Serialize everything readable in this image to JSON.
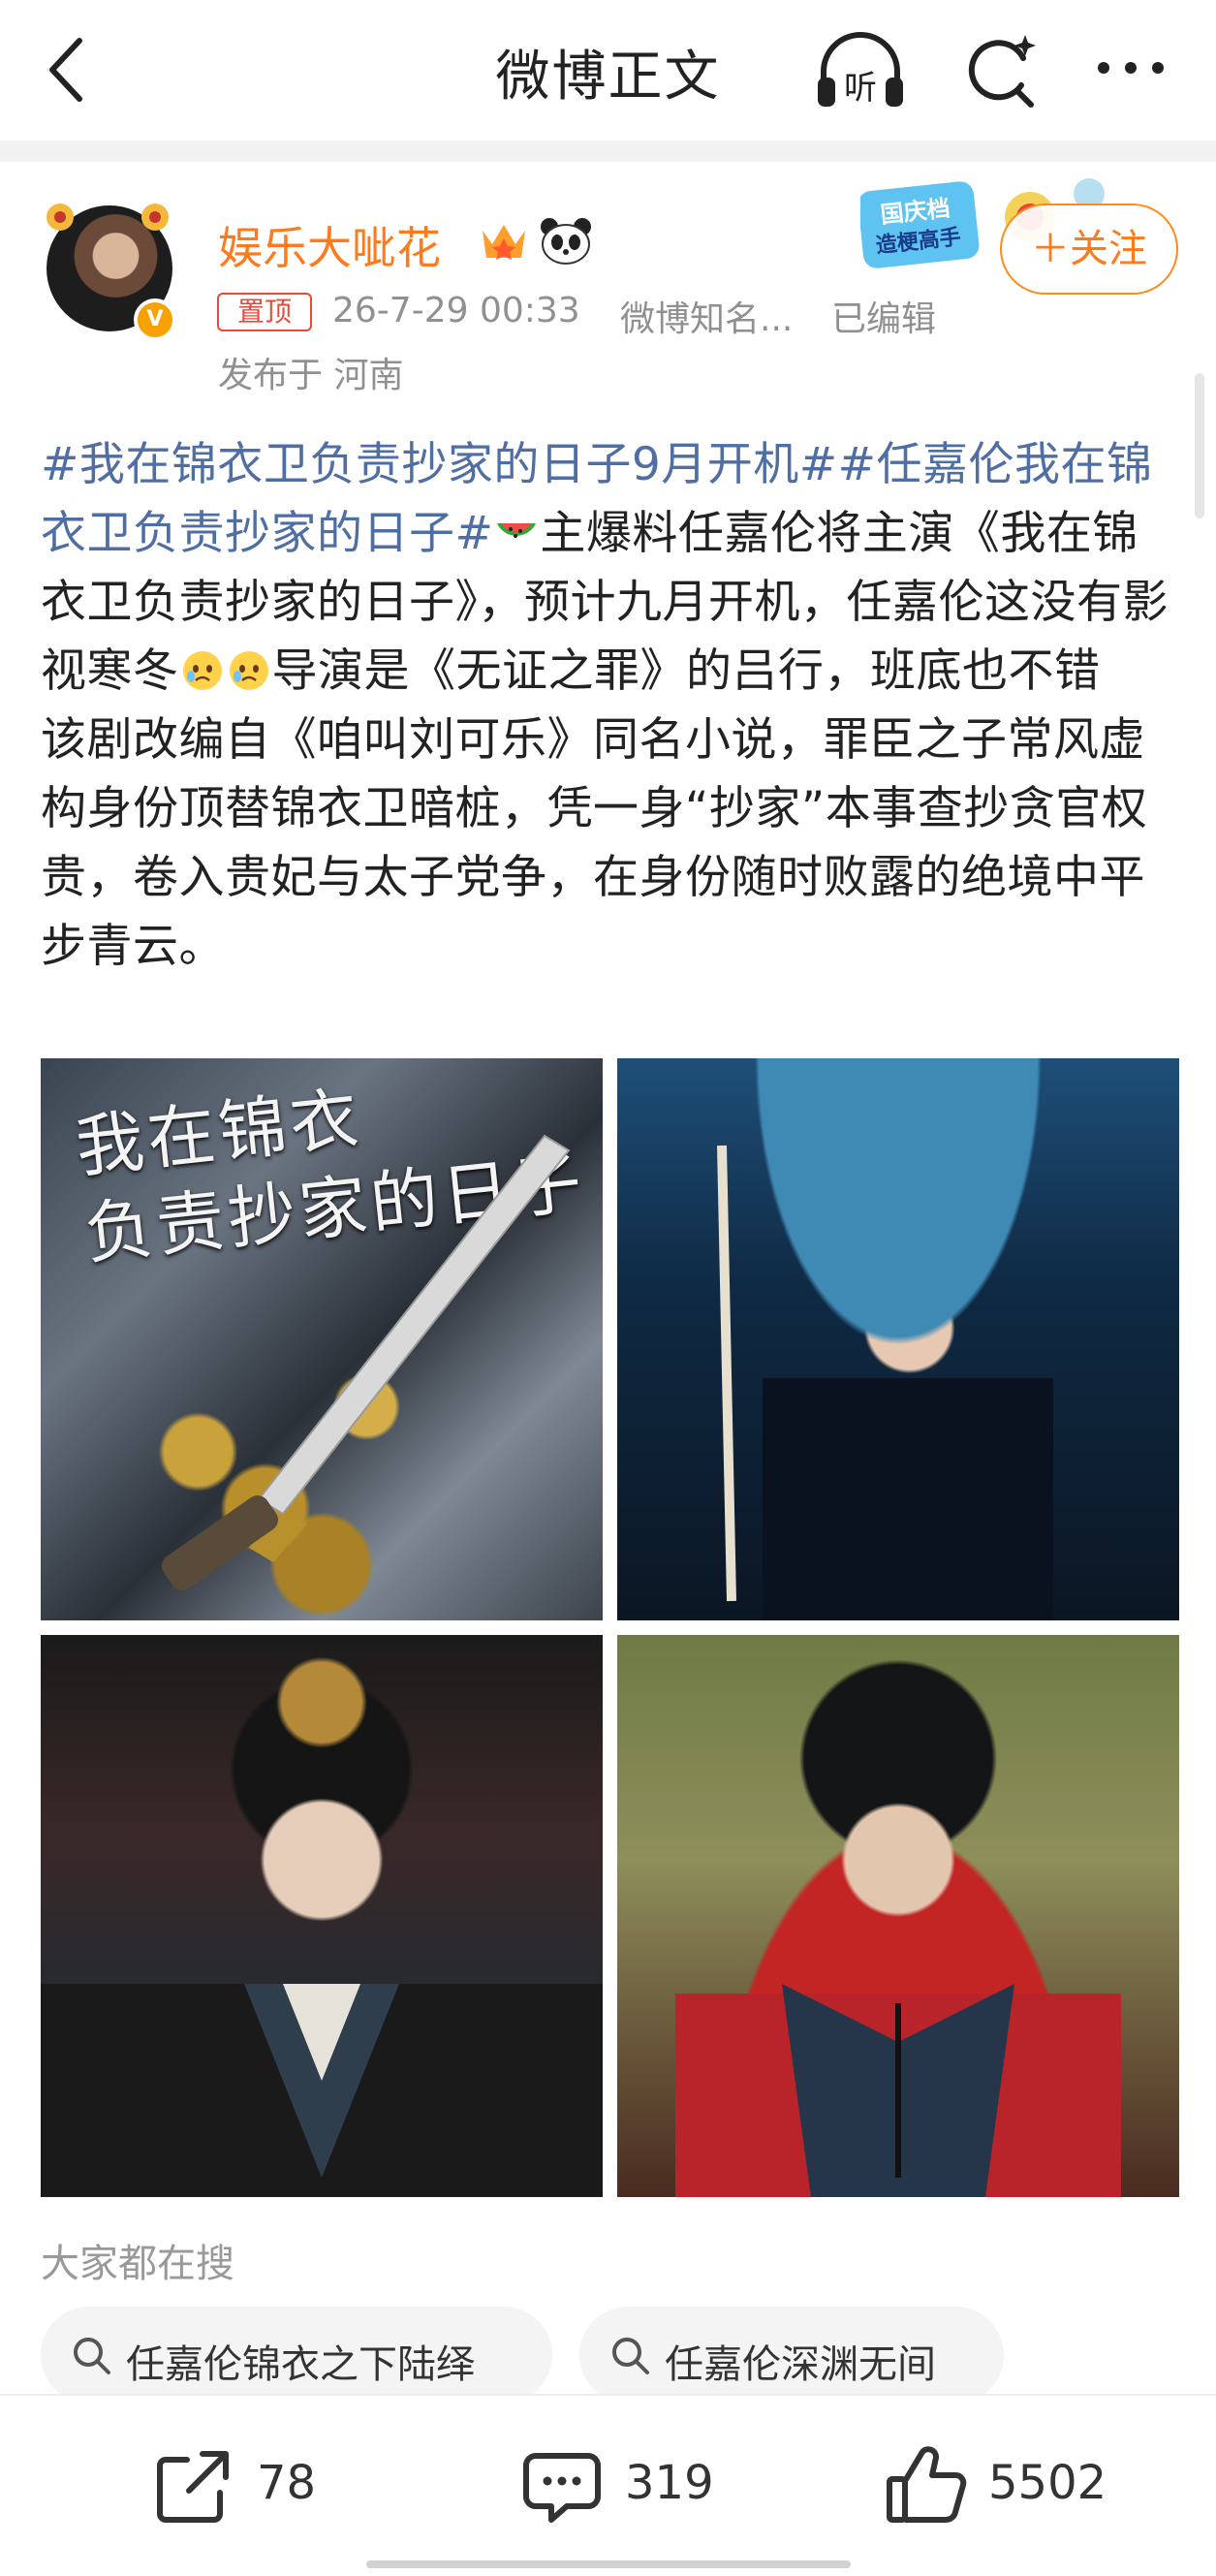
{
  "nav": {
    "title": "微博正文",
    "back_icon": "chevron-left-icon",
    "listen_icon": "headphones-icon",
    "listen_label": "听",
    "refresh_icon": "refresh-sparkle-icon",
    "more_icon": "more-dots-icon"
  },
  "post": {
    "author": "娱乐大呲花",
    "verified_icon": "verified-v-icon",
    "pinned_label": "置顶",
    "time": "26-7-29 00:33",
    "source": "微博知名...",
    "edited": "已编辑",
    "location": "发布于 河南",
    "follow_label": "＋关注",
    "event_banner": {
      "line1": "国庆档",
      "line2": "造梗高手"
    },
    "text": {
      "tag1": "#我在锦衣卫负责抄家的日子9月开机#",
      "tag2": "#任嘉伦我在锦衣卫负责抄家的日子#",
      "emoji_watermelon": "watermelon-emoji",
      "part1": "主爆料任嘉伦将主演《我在锦衣卫负责抄家的日子》，预计九月开机，任嘉伦这没有影视寒冬",
      "emoji_cry": "crying-face-emoji",
      "part2": "导演是《无证之罪》的吕行，班底也不错",
      "paragraph2": "该剧改编自《咱叫刘可乐》同名小说，罪臣之子常风虚构身份顶替锦衣卫暗桩，凭一身“抄家”本事查抄贪官权贵，卷入贵妃与太子党争，在身份随时败露的绝境中平步青云。"
    },
    "images": [
      {
        "caption": "我在锦衣\n负责抄家的日子",
        "desc": "poster-sword-gold-coins"
      },
      {
        "caption": "",
        "desc": "man-under-umbrella-rain"
      },
      {
        "caption": "",
        "desc": "man-golden-crown-fur"
      },
      {
        "caption": "",
        "desc": "man-black-hat-red-robe"
      }
    ]
  },
  "search": {
    "heading": "大家都在搜",
    "chips": [
      "任嘉伦锦衣之下陆绎",
      "任嘉伦深渊无间"
    ]
  },
  "actions": {
    "share_count": "78",
    "comment_count": "319",
    "like_count": "5502"
  },
  "colors": {
    "author": "#ff7a1a",
    "tag": "#4f6ea3",
    "meta": "#909090",
    "pinned": "#e84a3a"
  }
}
